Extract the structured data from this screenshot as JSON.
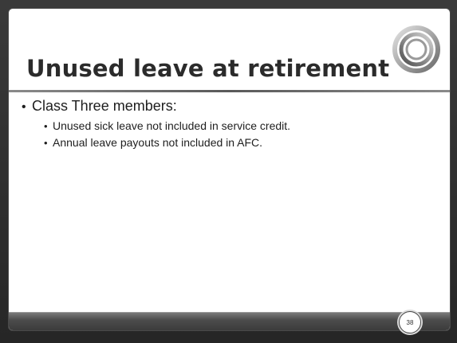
{
  "slide": {
    "title": "Unused leave at retirement",
    "logo_icon": "concentric-rings-icon",
    "page_number": "38",
    "bullets": [
      {
        "level": 1,
        "text": "Class Three members:"
      },
      {
        "level": 2,
        "text": "Unused sick leave not included in service credit."
      },
      {
        "level": 2,
        "text": "Annual leave payouts not included in AFC."
      }
    ],
    "bullet_glyph": "•"
  },
  "colors": {
    "frame": "#2f2f2f",
    "panel": "#ffffff",
    "title": "#2b2b2b",
    "logo_ring_light": "#c9c9c9",
    "logo_ring_dark": "#5d5d5d"
  }
}
